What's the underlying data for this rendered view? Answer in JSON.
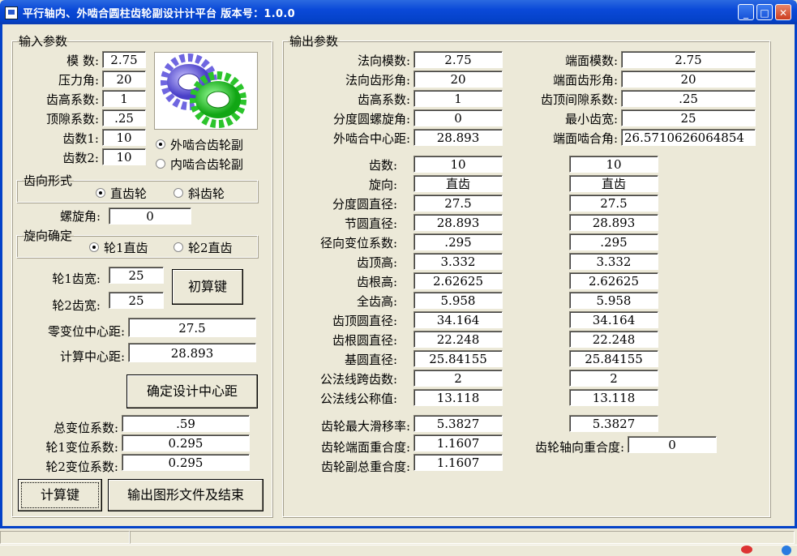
{
  "window": {
    "title": "平行轴内、外啮合圆柱齿轮副设计计平台  版本号：1.0.0"
  },
  "input": {
    "legend": "输入参数",
    "module_label": "模   数:",
    "module_value": "2.75",
    "pressure_angle_label": "压力角:",
    "pressure_angle_value": "20",
    "addendum_coef_label": "齿高系数:",
    "addendum_coef_value": "1",
    "clearance_coef_label": "顶隙系数:",
    "clearance_coef_value": ".25",
    "teeth1_label": "齿数1:",
    "teeth1_value": "10",
    "teeth2_label": "齿数2:",
    "teeth2_value": "10",
    "mesh_external_label": "外啮合齿轮副",
    "mesh_internal_label": "内啮合齿轮副",
    "tooth_form_legend": "齿向形式",
    "spur_label": "直齿轮",
    "helical_label": "斜齿轮",
    "helix_angle_label": "螺旋角:",
    "helix_angle_value": "0",
    "direction_legend": "旋向确定",
    "gear1_spur_label": "轮1直齿",
    "gear2_spur_label": "轮2直齿",
    "face_width1_label": "轮1齿宽:",
    "face_width1_value": "25",
    "face_width2_label": "轮2齿宽:",
    "face_width2_value": "25",
    "initial_calc_button": "初算键",
    "zero_shift_center_label": "零变位中心距:",
    "zero_shift_center_value": "27.5",
    "calc_center_label": "计算中心距:",
    "calc_center_value": "28.893",
    "confirm_center_button": "确定设计中心距",
    "total_shift_label": "总变位系数:",
    "total_shift_value": ".59",
    "shift1_label": "轮1变位系数:",
    "shift1_value": "0.295",
    "shift2_label": "轮2变位系数:",
    "shift2_value": "0.295",
    "calc_button": "计算键",
    "export_button": "输出图形文件及结束"
  },
  "output": {
    "legend": "输出参数",
    "normal_module_label": "法向模数:",
    "normal_module_value": "2.75",
    "normal_pressure_label": "法向齿形角:",
    "normal_pressure_value": "20",
    "addendum_coef_label": "齿高系数:",
    "addendum_coef_value": "1",
    "helix_label": "分度圆螺旋角:",
    "helix_value": "0",
    "ext_center_label": "外啮合中心距:",
    "ext_center_value": "28.893",
    "transverse_module_label": "端面模数:",
    "transverse_module_value": "2.75",
    "transverse_pressure_label": "端面齿形角:",
    "transverse_pressure_value": "20",
    "tip_clearance_label": "齿顶间隙系数:",
    "tip_clearance_value": ".25",
    "min_width_label": "最小齿宽:",
    "min_width_value": "25",
    "transverse_mesh_label": "端面啮合角:",
    "transverse_mesh_value": "26.5710626064854",
    "rows": [
      {
        "label": "齿数:",
        "g1": "10",
        "g2": "10"
      },
      {
        "label": "旋向:",
        "g1": "直齿",
        "g2": "直齿"
      },
      {
        "label": "分度圆直径:",
        "g1": "27.5",
        "g2": "27.5"
      },
      {
        "label": "节圆直径:",
        "g1": "28.893",
        "g2": "28.893"
      },
      {
        "label": "径向变位系数:",
        "g1": ".295",
        "g2": ".295"
      },
      {
        "label": "齿顶高:",
        "g1": "3.332",
        "g2": "3.332"
      },
      {
        "label": "齿根高:",
        "g1": "2.62625",
        "g2": "2.62625"
      },
      {
        "label": "全齿高:",
        "g1": "5.958",
        "g2": "5.958"
      },
      {
        "label": "齿顶圆直径:",
        "g1": "34.164",
        "g2": "34.164"
      },
      {
        "label": "齿根圆直径:",
        "g1": "22.248",
        "g2": "22.248"
      },
      {
        "label": "基圆直径:",
        "g1": "25.84155",
        "g2": "25.84155"
      },
      {
        "label": "公法线跨齿数:",
        "g1": "2",
        "g2": "2"
      },
      {
        "label": "公法线公称值:",
        "g1": "13.118",
        "g2": "13.118"
      }
    ],
    "max_slip_label": "齿轮最大滑移率:",
    "max_slip_g1": "5.3827",
    "max_slip_g2": "5.3827",
    "transverse_contact_label": "齿轮端面重合度:",
    "transverse_contact_value": "1.1607",
    "axial_contact_label": "齿轮轴向重合度:",
    "axial_contact_value": "0",
    "total_contact_label": "齿轮副总重合度:",
    "total_contact_value": "1.1607"
  }
}
